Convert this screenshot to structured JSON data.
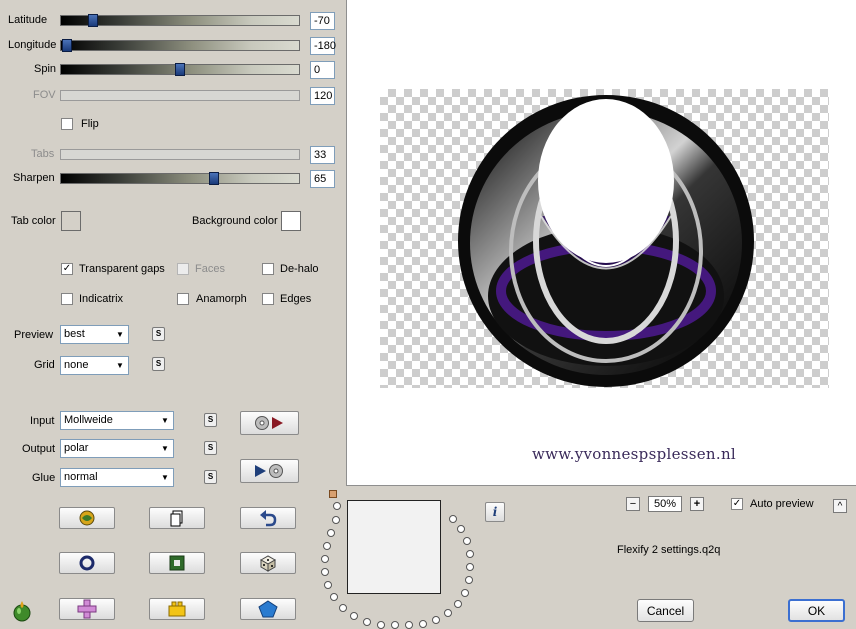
{
  "params": {
    "latitude": {
      "label": "Latitude",
      "value": "-70",
      "fraction": 0.11
    },
    "longitude": {
      "label": "Longitude",
      "value": "-180",
      "fraction": 0.0
    },
    "spin": {
      "label": "Spin",
      "value": "0",
      "fraction": 0.5
    },
    "fov": {
      "label": "FOV",
      "value": "120"
    },
    "flip": {
      "label": "Flip",
      "checked": false
    },
    "tabs": {
      "label": "Tabs",
      "value": "33"
    },
    "sharpen": {
      "label": "Sharpen",
      "value": "65",
      "fraction": 0.65
    }
  },
  "colors": {
    "tab_color_label": "Tab color",
    "tab_color": "#d4d0c8",
    "background_color_label": "Background color",
    "background_color": "#ffffff"
  },
  "options": {
    "transparent_gaps": {
      "label": "Transparent gaps",
      "checked": true
    },
    "faces": {
      "label": "Faces",
      "checked": false,
      "disabled": true
    },
    "de_halo": {
      "label": "De-halo",
      "checked": false
    },
    "indicatrix": {
      "label": "Indicatrix",
      "checked": false
    },
    "anamorph": {
      "label": "Anamorph",
      "checked": false
    },
    "edges": {
      "label": "Edges",
      "checked": false
    }
  },
  "selects": {
    "preview": {
      "label": "Preview",
      "value": "best"
    },
    "grid": {
      "label": "Grid",
      "value": "none"
    },
    "input": {
      "label": "Input",
      "value": "Mollweide"
    },
    "output": {
      "label": "Output",
      "value": "polar"
    },
    "glue": {
      "label": "Glue",
      "value": "normal"
    }
  },
  "small_button_glyph": "S",
  "watermark": "www.yvonnespsplessen.nl",
  "bottom": {
    "zoom": "50%",
    "zoom_minus": "−",
    "zoom_plus": "+",
    "auto_preview_label": "Auto preview",
    "auto_preview_checked": true,
    "settings_file": "Flexify 2 settings.q2q",
    "cancel_label": "Cancel",
    "ok_label": "OK",
    "info_glyph": "i",
    "collapse_glyph": "^"
  }
}
